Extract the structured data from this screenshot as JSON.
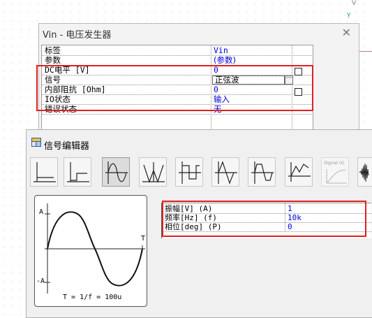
{
  "vin_dialog": {
    "title": "Vin - 电压发生器",
    "rows": [
      {
        "label": "标签",
        "value": "Vin"
      },
      {
        "label": "参数",
        "value": "(参数)"
      },
      {
        "label": "DC电平 [V]",
        "value": "0"
      },
      {
        "label": "信号",
        "value": "正弦波"
      },
      {
        "label": "内部阻抗 [Ohm]",
        "value": "0"
      },
      {
        "label": "IO状态",
        "value": "输入"
      },
      {
        "label": "错误状态",
        "value": "无"
      }
    ],
    "more_button": "···"
  },
  "signal_editor": {
    "title": "信号编辑器",
    "waveforms": [
      {
        "icon": "step-icon"
      },
      {
        "icon": "delayed-step-icon"
      },
      {
        "icon": "sine-icon",
        "selected": true
      },
      {
        "icon": "damped-sine-icon"
      },
      {
        "icon": "square-wave-icon"
      },
      {
        "icon": "triangle-wave-icon"
      },
      {
        "icon": "trapezoid-wave-icon"
      },
      {
        "icon": "piecewise-linear-icon"
      },
      {
        "icon": "signal-from-file-icon",
        "label": "Signal (t)",
        "disabled": true
      },
      {
        "icon": "noise-icon"
      }
    ],
    "preview": {
      "a_pos": "A",
      "a_neg": "-A",
      "t_label": "T",
      "formula": "T = 1/f = 100u"
    },
    "params": [
      {
        "label": "振幅[V] (A)",
        "value": "1"
      },
      {
        "label": "频率[Hz] (f)",
        "value": "10k"
      },
      {
        "label": "相位[deg] (P)",
        "value": "0"
      }
    ]
  },
  "colors": {
    "value_text": "#0000d8",
    "highlight_border": "#e02020"
  }
}
